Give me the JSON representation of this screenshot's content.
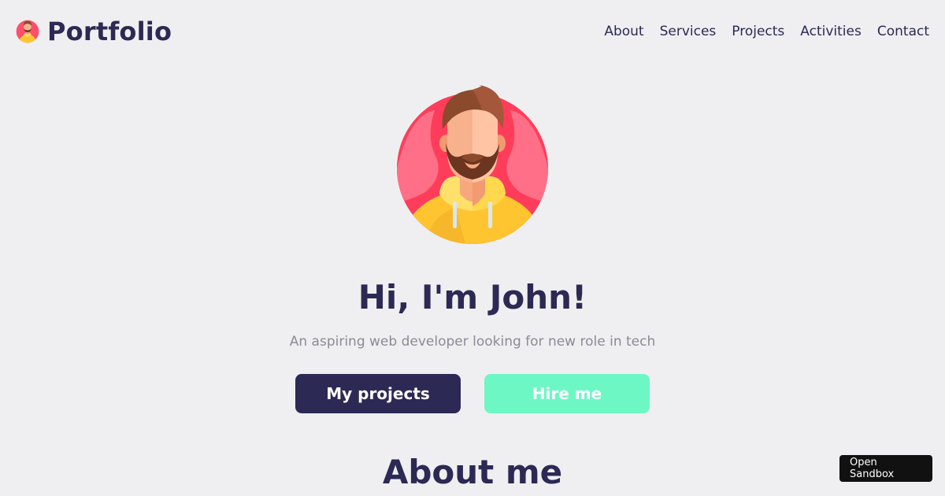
{
  "header": {
    "brand": {
      "title": "Portfolio",
      "avatar_icon": "avatar-icon"
    },
    "nav": [
      {
        "label": "About"
      },
      {
        "label": "Services"
      },
      {
        "label": "Projects"
      },
      {
        "label": "Activities"
      },
      {
        "label": "Contact"
      }
    ]
  },
  "hero": {
    "avatar_icon": "avatar-illustration",
    "title": "Hi, I'm John!",
    "subtitle": "An aspiring web developer looking for new role in tech",
    "buttons": {
      "projects": "My projects",
      "hire": "Hire me"
    }
  },
  "about": {
    "title": "About me"
  },
  "sandbox": {
    "label": "Open Sandbox"
  },
  "colors": {
    "background": "#efeff1",
    "primary": "#2c2954",
    "accent": "#6df7c4",
    "muted_text": "#8b8a98"
  }
}
